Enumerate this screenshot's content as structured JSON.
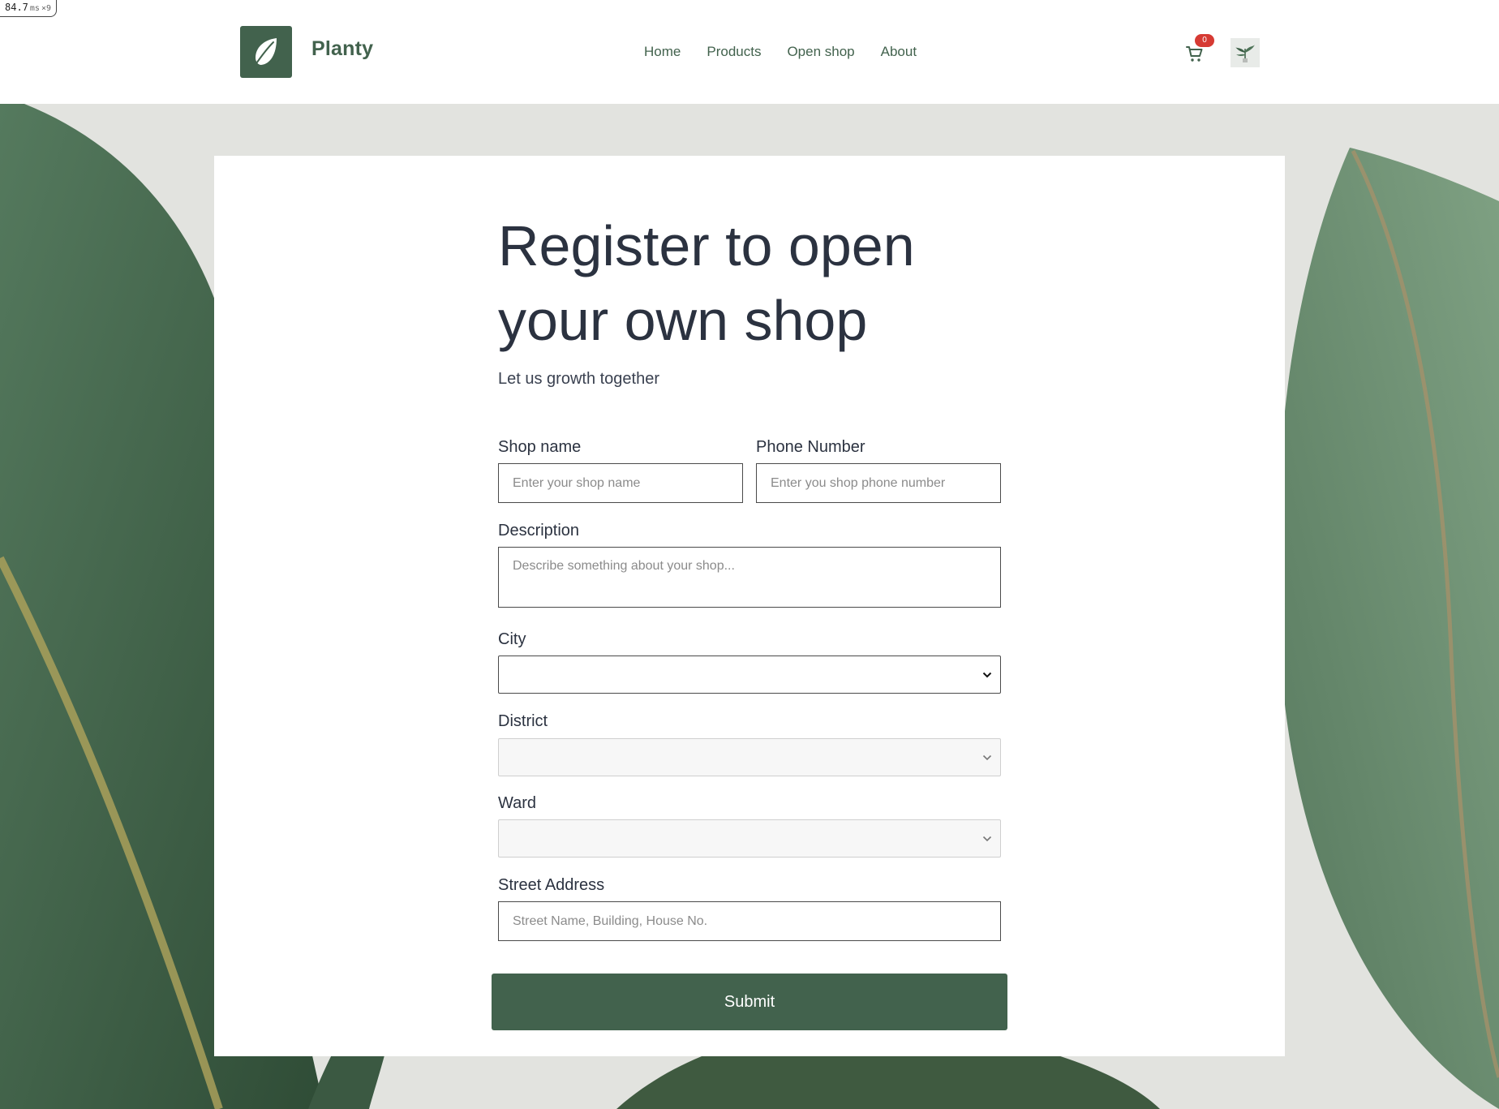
{
  "perf": {
    "value": "84.7",
    "unit": "ms",
    "multiplier": "×9"
  },
  "header": {
    "brand": "Planty",
    "nav": [
      "Home",
      "Products",
      "Open shop",
      "About"
    ],
    "cart_count": "0"
  },
  "form": {
    "title": "Register to open your own shop",
    "subtitle": "Let us growth together",
    "shop_name": {
      "label": "Shop name",
      "placeholder": "Enter your shop name"
    },
    "phone": {
      "label": "Phone Number",
      "placeholder": "Enter you shop phone number"
    },
    "description": {
      "label": "Description",
      "placeholder": "Describe something about your shop..."
    },
    "city": {
      "label": "City",
      "value": ""
    },
    "district": {
      "label": "District",
      "value": ""
    },
    "ward": {
      "label": "Ward",
      "value": ""
    },
    "street": {
      "label": "Street Address",
      "placeholder": "Street Name, Building, House No."
    },
    "submit_label": "Submit"
  },
  "colors": {
    "brand_green": "#42624d",
    "badge_red": "#d63a33",
    "background": "#e2e3df"
  },
  "icons": {
    "logo": "leaf-icon",
    "cart": "cart-icon",
    "avatar": "plant-avatar-icon",
    "select_arrow": "chevron-down-icon"
  }
}
